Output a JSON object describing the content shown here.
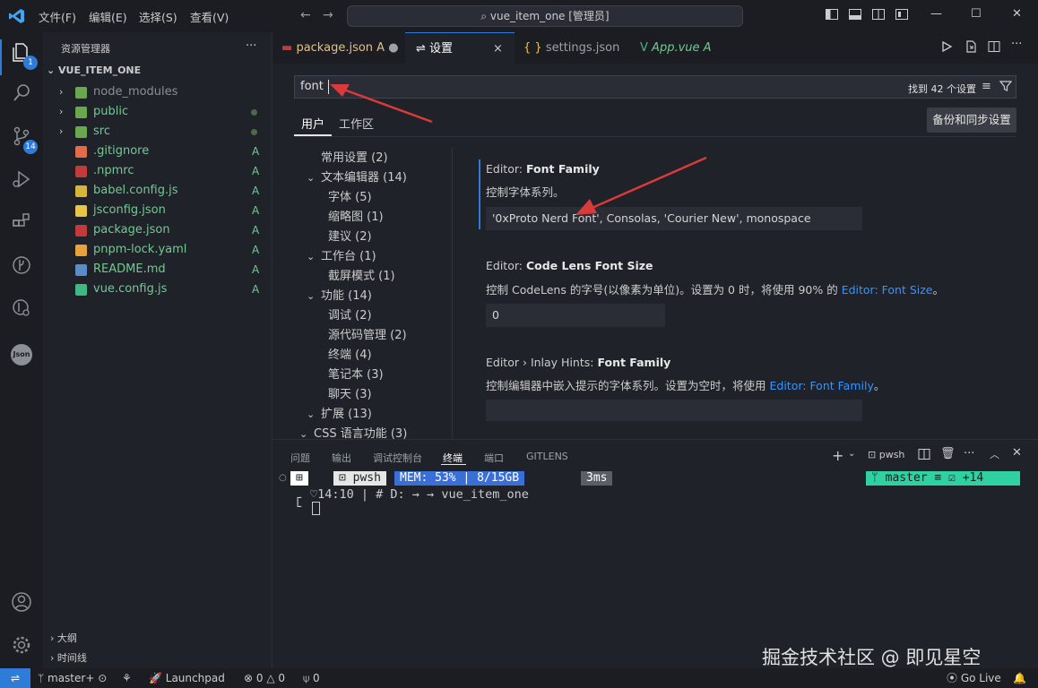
{
  "menu": [
    "文件(F)",
    "编辑(E)",
    "选择(S)",
    "查看(V)"
  ],
  "command_center": "vue_item_one [管理员]",
  "activity": {
    "explorer_badge": "1",
    "scm_badge": "14",
    "json_label": "Json"
  },
  "sidebar": {
    "title": "资源管理器",
    "more": "···",
    "root": "VUE_ITEM_ONE",
    "items": [
      {
        "name": "node_modules",
        "status": "",
        "icon": "#6aa84f"
      },
      {
        "name": "public",
        "status": "dot",
        "icon": "#6aa84f"
      },
      {
        "name": "src",
        "status": "dot",
        "icon": "#6aa84f"
      },
      {
        "name": ".gitignore",
        "status": "A",
        "icon": "#e06c4a"
      },
      {
        "name": ".npmrc",
        "status": "A",
        "icon": "#c23a3a"
      },
      {
        "name": "babel.config.js",
        "status": "A",
        "icon": "#d6b63a"
      },
      {
        "name": "jsconfig.json",
        "status": "A",
        "icon": "#e8c44a"
      },
      {
        "name": "package.json",
        "status": "A",
        "icon": "#c23a3a"
      },
      {
        "name": "pnpm-lock.yaml",
        "status": "A",
        "icon": "#e8a23a"
      },
      {
        "name": "README.md",
        "status": "A",
        "icon": "#5a8cc8"
      },
      {
        "name": "vue.config.js",
        "status": "A",
        "icon": "#41b883"
      }
    ],
    "outline": "大纲",
    "timeline": "时间线"
  },
  "tabs": [
    {
      "label": "package.json",
      "suffix": "A"
    },
    {
      "label": "设置",
      "suffix": "×"
    },
    {
      "label": "settings.json",
      "suffix": ""
    },
    {
      "label": "App.vue",
      "suffix": "A"
    }
  ],
  "settings": {
    "search_value": "font",
    "found": "找到 42 个设置",
    "scope_user": "用户",
    "scope_workspace": "工作区",
    "sync": "备份和同步设置",
    "toc": [
      {
        "label": "常用设置 (2)",
        "indent": 0,
        "chev": ""
      },
      {
        "label": "文本编辑器 (14)",
        "indent": 0,
        "chev": "v"
      },
      {
        "label": "字体 (5)",
        "indent": 1,
        "chev": ""
      },
      {
        "label": "缩略图 (1)",
        "indent": 1,
        "chev": ""
      },
      {
        "label": "建议 (2)",
        "indent": 1,
        "chev": ""
      },
      {
        "label": "工作台 (1)",
        "indent": 0,
        "chev": "v"
      },
      {
        "label": "截屏模式 (1)",
        "indent": 1,
        "chev": ""
      },
      {
        "label": "功能 (14)",
        "indent": 0,
        "chev": "v"
      },
      {
        "label": "调试 (2)",
        "indent": 1,
        "chev": ""
      },
      {
        "label": "源代码管理 (2)",
        "indent": 1,
        "chev": ""
      },
      {
        "label": "终端 (4)",
        "indent": 1,
        "chev": ""
      },
      {
        "label": "笔记本 (3)",
        "indent": 1,
        "chev": ""
      },
      {
        "label": "聊天 (3)",
        "indent": 1,
        "chev": ""
      },
      {
        "label": "扩展 (13)",
        "indent": 0,
        "chev": "v"
      },
      {
        "label": "CSS 语言功能 (3)",
        "indent": 0.5,
        "chev": "v"
      }
    ],
    "s1_prefix": "Editor: ",
    "s1_name": "Font Family",
    "s1_desc": "控制字体系列。",
    "s1_value": "'0xProto Nerd Font', Consolas, 'Courier New', monospace",
    "s2_prefix": "Editor: ",
    "s2_name": "Code Lens Font Size",
    "s2_desc": "控制 CodeLens 的字号(以像素为单位)。设置为 0 时，将使用 90% 的 ",
    "s2_link": "Editor: Font Size",
    "s2_end": "。",
    "s2_value": "0",
    "s3_prefix": "Editor › Inlay Hints: ",
    "s3_name": "Font Family",
    "s3_desc": "控制编辑器中嵌入提示的字体系列。设置为空时，将使用 ",
    "s3_link": "Editor: Font Family",
    "s3_end": "。"
  },
  "panel": {
    "tabs": [
      "问题",
      "输出",
      "调试控制台",
      "终端",
      "端口",
      "GITLENS"
    ],
    "shell": "pwsh",
    "prompt": {
      "shell": "pwsh",
      "mem": "MEM: 53% | 8/15GB",
      "time": "3ms",
      "branch": "master ≡ ☑ +14"
    },
    "line2": "14:10 | #  D: →  → ",
    "cwd": "vue_item_one"
  },
  "status": {
    "branch": "master+",
    "launchpad": "Launchpad",
    "errors": "0",
    "warnings": "0",
    "ports": "0",
    "golive": "Go Live"
  },
  "watermark": "掘金技术社区 @ 即见星空",
  "colors": {
    "accent": "#2f7bd8",
    "terminal_green": "#2fd1a0"
  }
}
